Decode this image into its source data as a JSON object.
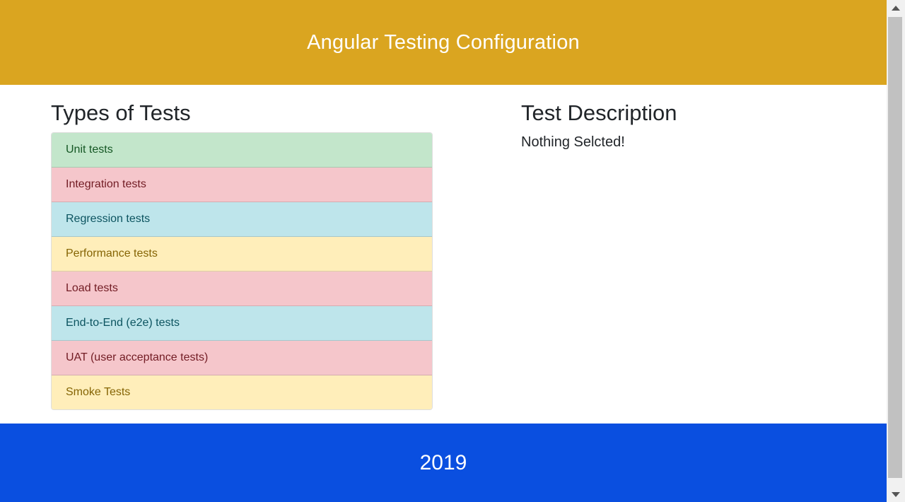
{
  "header": {
    "title": "Angular Testing Configuration",
    "background": "#daa520"
  },
  "tests": {
    "title": "Types of Tests",
    "items": [
      {
        "label": "Unit tests",
        "variant": "success",
        "bg": "#c3e6cb",
        "fg": "#155724"
      },
      {
        "label": "Integration tests",
        "variant": "danger",
        "bg": "#f5c6cb",
        "fg": "#721c24"
      },
      {
        "label": "Regression tests",
        "variant": "info",
        "bg": "#bee5eb",
        "fg": "#0c5460"
      },
      {
        "label": "Performance tests",
        "variant": "warning",
        "bg": "#ffeeba",
        "fg": "#856404"
      },
      {
        "label": "Load tests",
        "variant": "danger",
        "bg": "#f5c6cb",
        "fg": "#721c24"
      },
      {
        "label": "End-to-End (e2e) tests",
        "variant": "info",
        "bg": "#bee5eb",
        "fg": "#0c5460"
      },
      {
        "label": "UAT (user acceptance tests)",
        "variant": "danger",
        "bg": "#f5c6cb",
        "fg": "#721c24"
      },
      {
        "label": "Smoke Tests",
        "variant": "warning",
        "bg": "#ffeeba",
        "fg": "#856404"
      }
    ]
  },
  "description": {
    "title": "Test Description",
    "text": "Nothing Selcted!"
  },
  "footer": {
    "text": "2019",
    "background": "#0a4fe0"
  },
  "scrollbar": {
    "up_icon": "triangle-up-icon",
    "down_icon": "triangle-down-icon"
  }
}
